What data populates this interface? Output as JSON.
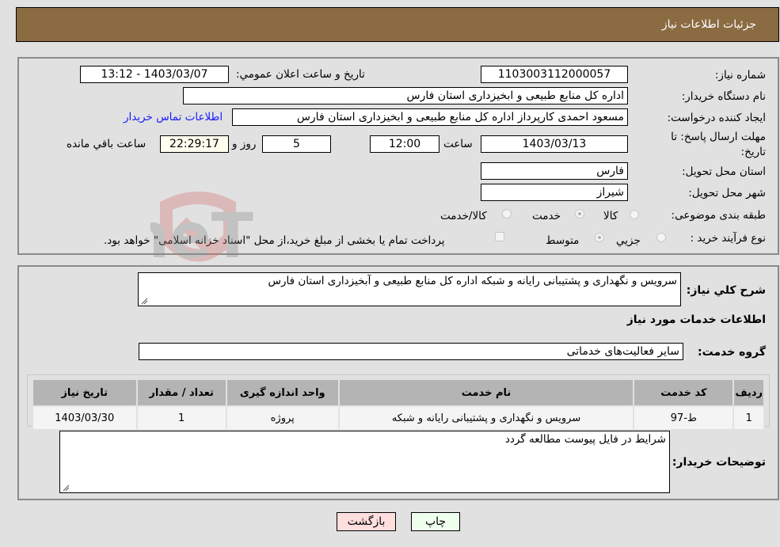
{
  "header": {
    "title": "جزئيات اطلاعات نياز"
  },
  "details": {
    "need_number_label": "شماره نیاز:",
    "need_number": "1103003112000057",
    "announce_label": "تاریخ و ساعت اعلان عمومي:",
    "announce_value": "1403/03/07 - 13:12",
    "buyer_org_label": "نام دستگاه خریدار:",
    "buyer_org": "اداره کل منابع طبیعی و ابخیزداری استان فارس",
    "creator_label": "ایجاد کننده درخواست:",
    "creator": "مسعود احمدی کارپرداز اداره کل منابع طبیعی و ابخیزداری استان فارس",
    "contact_link": "اطلاعات تماس خریدار",
    "deadline_label": "مهلت ارسال پاسخ: تا تاریخ:",
    "deadline_date": "1403/03/13",
    "time_label": "ساعت",
    "deadline_time": "12:00",
    "days_value": "5",
    "days_label": "روز و",
    "remaining_time": "22:29:17",
    "remaining_label": "ساعت باقي مانده",
    "province_label": "استان محل تحویل:",
    "province": "فارس",
    "city_label": "شهر محل تحویل:",
    "city": "شیراز",
    "category_label": "طبقه بندی موضوعی:",
    "category_options": [
      {
        "label": "کالا",
        "checked": false
      },
      {
        "label": "خدمت",
        "checked": true
      },
      {
        "label": "کالا/خدمت",
        "checked": false
      }
    ],
    "process_label": "نوع فرآیند خرید :",
    "process_options": [
      {
        "label": "جزيي",
        "checked": false
      },
      {
        "label": "متوسط",
        "checked": true
      }
    ],
    "treasury_note": "پرداخت تمام یا بخشی از مبلغ خرید،از محل \"اسناد خزانه اسلامی\" خواهد بود."
  },
  "services": {
    "description_label": "شرح كلي نياز:",
    "description": "سرویس و نگهداری و پشتیبانی رایانه و شبکه اداره کل منابع طبیعی و آبخیزداری استان فارس",
    "section_title": "اطلاعات خدمات مورد نياز",
    "group_label": "گروه خدمت:",
    "group_value": "سایر فعالیت‌های خدماتی",
    "table": {
      "headers": [
        "ردیف",
        "کد خدمت",
        "نام خدمت",
        "واحد اندازه گیری",
        "تعداد / مقدار",
        "تاریخ نیاز"
      ],
      "rows": [
        [
          "1",
          "ط-97",
          "سرویس و نگهداری و پشتیبانی رایانه و شبکه",
          "پروژه",
          "1",
          "1403/03/30"
        ]
      ]
    },
    "buyer_notes_label": "توضیحات خریدار:",
    "buyer_notes": "شرایط در فایل پیوست مطالعه گردد"
  },
  "buttons": {
    "print": "چاپ",
    "back": "بازگشت"
  },
  "watermark": "AriaTender.neT"
}
